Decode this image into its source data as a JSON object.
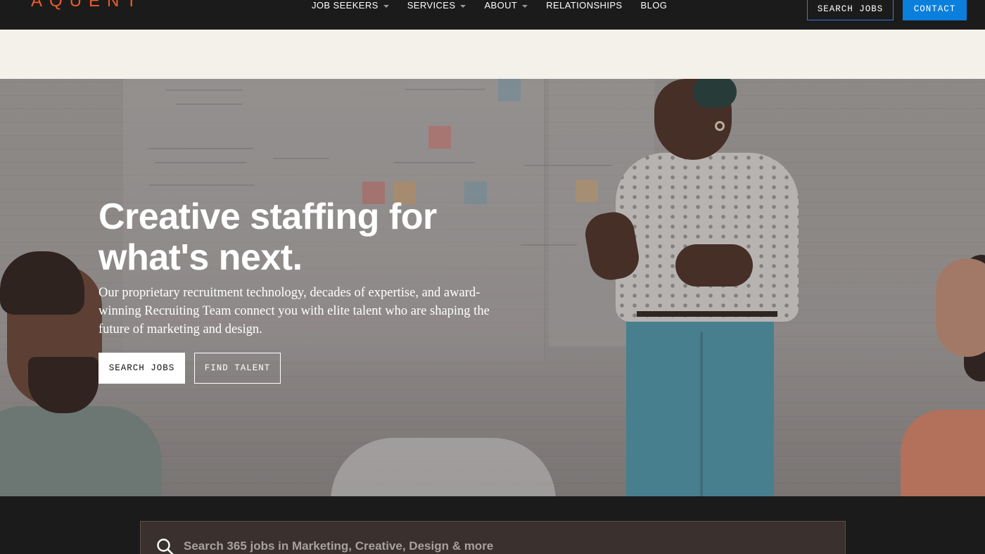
{
  "brand": {
    "logo_text": "AQUENT",
    "logo_color": "#ef5b2b"
  },
  "nav": {
    "items": [
      {
        "label": "JOB SEEKERS",
        "has_dropdown": true
      },
      {
        "label": "SERVICES",
        "has_dropdown": true
      },
      {
        "label": "ABOUT",
        "has_dropdown": true
      },
      {
        "label": "RELATIONSHIPS",
        "has_dropdown": false
      },
      {
        "label": "BLOG",
        "has_dropdown": false
      }
    ],
    "search_jobs_label": "SEARCH JOBS",
    "contact_label": "CONTACT",
    "accent": "#0a7fdc"
  },
  "hero": {
    "title": "Creative staffing for what's next.",
    "subtitle": "Our proprietary recruitment technology, decades of expertise, and award-winning Recruiting Team connect you with elite talent who are shaping the future of marketing and design.",
    "search_jobs_label": "SEARCH JOBS",
    "find_talent_label": "FIND TALENT"
  },
  "job_search": {
    "placeholder": "Search 365 jobs in Marketing, Creative, Design & more",
    "icon": "search-icon"
  }
}
